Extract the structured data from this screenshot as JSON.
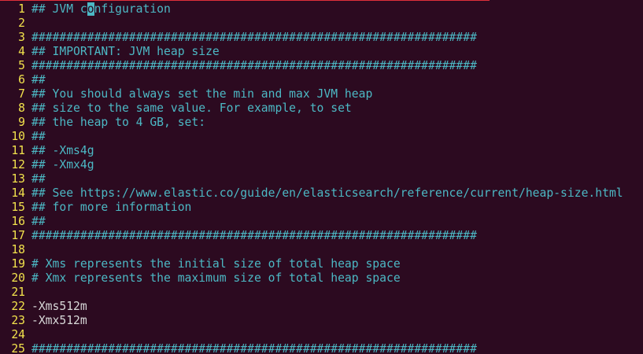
{
  "editor": {
    "theme_colors": {
      "background": "#2c0a20",
      "line_number": "#f2e24c",
      "comment": "#4cb8c4",
      "plain": "#d8d8d8"
    },
    "cursor": {
      "line": 1,
      "before": "## JVM c",
      "char": "o",
      "after": "nfiguration"
    },
    "lines": [
      {
        "n": "1",
        "text": "## JVM configuration",
        "kind": "comment"
      },
      {
        "n": "2",
        "text": "",
        "kind": "comment"
      },
      {
        "n": "3",
        "text": "################################################################",
        "kind": "comment"
      },
      {
        "n": "4",
        "text": "## IMPORTANT: JVM heap size",
        "kind": "comment"
      },
      {
        "n": "5",
        "text": "################################################################",
        "kind": "comment"
      },
      {
        "n": "6",
        "text": "##",
        "kind": "comment"
      },
      {
        "n": "7",
        "text": "## You should always set the min and max JVM heap",
        "kind": "comment"
      },
      {
        "n": "8",
        "text": "## size to the same value. For example, to set",
        "kind": "comment"
      },
      {
        "n": "9",
        "text": "## the heap to 4 GB, set:",
        "kind": "comment"
      },
      {
        "n": "10",
        "text": "##",
        "kind": "comment"
      },
      {
        "n": "11",
        "text": "## -Xms4g",
        "kind": "comment"
      },
      {
        "n": "12",
        "text": "## -Xmx4g",
        "kind": "comment"
      },
      {
        "n": "13",
        "text": "##",
        "kind": "comment"
      },
      {
        "n": "14",
        "text": "## See https://www.elastic.co/guide/en/elasticsearch/reference/current/heap-size.html",
        "kind": "comment"
      },
      {
        "n": "15",
        "text": "## for more information",
        "kind": "comment"
      },
      {
        "n": "16",
        "text": "##",
        "kind": "comment"
      },
      {
        "n": "17",
        "text": "################################################################",
        "kind": "comment"
      },
      {
        "n": "18",
        "text": "",
        "kind": "comment"
      },
      {
        "n": "19",
        "text": "# Xms represents the initial size of total heap space",
        "kind": "comment"
      },
      {
        "n": "20",
        "text": "# Xmx represents the maximum size of total heap space",
        "kind": "comment"
      },
      {
        "n": "21",
        "text": "",
        "kind": "comment"
      },
      {
        "n": "22",
        "text": "-Xms512m",
        "kind": "plain"
      },
      {
        "n": "23",
        "text": "-Xmx512m",
        "kind": "plain"
      },
      {
        "n": "24",
        "text": "",
        "kind": "comment"
      },
      {
        "n": "25",
        "text": "################################################################",
        "kind": "comment"
      }
    ]
  }
}
